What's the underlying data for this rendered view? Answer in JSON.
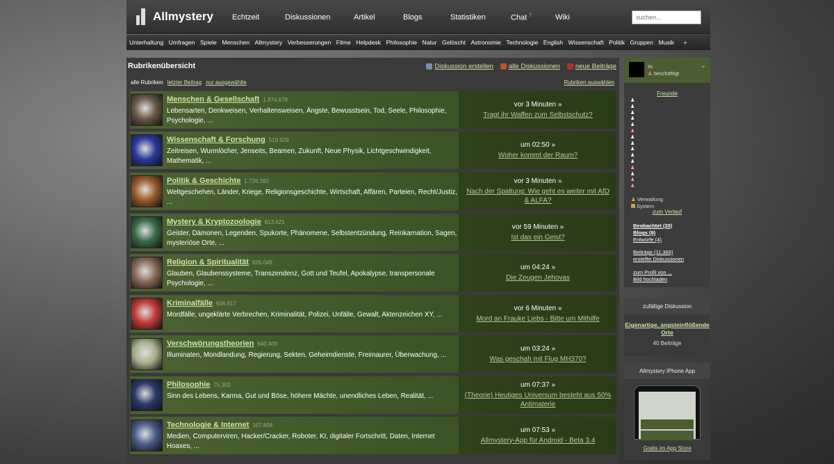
{
  "header": {
    "logo": "Allmystery",
    "nav": [
      "Echtzeit",
      "Diskussionen",
      "Artikel",
      "Blogs",
      "Statistiken",
      "Chat",
      "Wiki"
    ],
    "chat_count": "7",
    "search_placeholder": "suchen..."
  },
  "categories": [
    "Unterhaltung",
    "Umfragen",
    "Spiele",
    "Menschen",
    "Allmystery",
    "Verbesserungen",
    "Filme",
    "Helpdesk",
    "Philosophie",
    "Natur",
    "Gelöscht",
    "Astronomie",
    "Technologie",
    "English",
    "Wissenschaft",
    "Politik",
    "Gruppen",
    "Musik",
    "+"
  ],
  "main": {
    "title": "Rubrikenübersicht",
    "links": [
      "Diskussion erstellen",
      "alle Diskussionen",
      "neue Beiträge"
    ],
    "filters": [
      "alle Rubriken",
      "letzter Beitrag",
      "nur ausgewählte"
    ],
    "choose": "Rubriken auswählen",
    "rows": [
      {
        "title": "Menschen & Gesellschaft",
        "count": "1.874.678",
        "desc": "Lebensarten, Denkweisen, Verhaltensweisen, Ängste, Bewusstsein, Tod, Seele, Philosophie, Psychologie, ...",
        "time": "vor 3 Minuten »",
        "last": "Tragt ihr Waffen zum Selbstschutz?",
        "thumb": "#6a5a48"
      },
      {
        "title": "Wissenschaft & Forschung",
        "count": "519.929",
        "desc": "Zeitreisen, Wurmlöcher, Jenseits, Beamen, Zukunft, Neue Physik, Lichtgeschwindigkeit, Mathematik, ...",
        "time": "um 02:50 »",
        "last": "Woher kommt der Raum?",
        "thumb": "#2a3a9a"
      },
      {
        "title": "Politik & Geschichte",
        "count": "1.726.392",
        "desc": "Weltgeschehen, Länder, Kriege, Religionsgeschichte, Wirtschaft, Affären, Parteien, Recht/Justiz, ...",
        "time": "vor 3 Minuten »",
        "last": "Nach der Spaltung: Wie geht es weiter mit AfD & ALFA?",
        "thumb": "#9a5a2a"
      },
      {
        "title": "Mystery & Kryptozoologie",
        "count": "813.621",
        "desc": "Geister, Dämonen, Legenden, Spukorte, Phänomene, Selbstentzündung, Reinkarnation, Sagen, mysteriöse Orte, ...",
        "time": "vor 59 Minuten »",
        "last": "Ist das ein Geist?",
        "thumb": "#3a6a4a"
      },
      {
        "title": "Religion & Spiritualität",
        "count": "826.049",
        "desc": "Glauben, Glaubenssysteme, Transzendenz, Gott und Teufel, Apokalypse, transpersonale Psychologie, ...",
        "time": "um 04:24 »",
        "last": "Die Zeugen Jehovas",
        "thumb": "#8a6a5a"
      },
      {
        "title": "Kriminalfälle",
        "count": "606.617",
        "desc": "Mordfälle, ungeklärte Verbrechen, Kriminalität, Polizei, Unfälle, Gewalt, Aktenzeichen XY, ...",
        "time": "vor 6 Minuten »",
        "last": "Mord an Frauke Liebs - Bitte um Mithilfe",
        "thumb": "#c23a3a"
      },
      {
        "title": "Verschwörungstheorien",
        "count": "640.409",
        "desc": "Illuminaten, Mondlandung, Regierung, Sekten, Geheimdienste, Freimaurer, Überwachung, ...",
        "time": "um 03:24 »",
        "last": "Was geschah mit Flug MH370?",
        "thumb": "#a8b08a"
      },
      {
        "title": "Philosophie",
        "count": "75.302",
        "desc": "Sinn des Lebens, Karma, Gut und Böse, höhere Mächte, unendliches Leben, Realität, ...",
        "time": "um 07:37 »",
        "last": "(Theorie) Heutiges Universum besteht aus 50% Antimaterie",
        "thumb": "#2a3a6a"
      },
      {
        "title": "Technologie & Internet",
        "count": "107.804",
        "desc": "Medien, Computerviren, Hacker/Cracker, Roboter, KI, digitaler Fortschritt, Daten, Internet Hoaxes, ...",
        "time": "um 07:53 »",
        "last": "Allmystery-App für Android - Beta 3.4",
        "thumb": "#4a5a8a"
      }
    ]
  },
  "sidebar": {
    "user": "tic",
    "status": "beschäftigt",
    "friends_link": "Freunde",
    "legend": [
      "Verwaltung",
      "System"
    ],
    "history_link": "zum Verlauf",
    "links1": [
      "Beobachtet (20)",
      "Blogs (9)",
      "Entwürfe (4)"
    ],
    "links2": [
      "Beiträge (11.366)",
      "erstellte Diskussionen"
    ],
    "links3": [
      "zum Profil von ...",
      "Bild hochladen"
    ],
    "random_head": "zufällige Diskussion",
    "random_title": "Eigenartige, angsteinflößende Orte",
    "random_count": "40 Beiträge",
    "app_head": "Allmystery iPhone App",
    "app_link": "Gratis im App Store"
  }
}
